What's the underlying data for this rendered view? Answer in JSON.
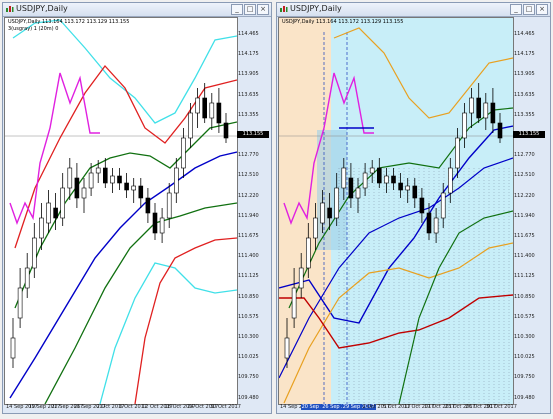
{
  "windows": [
    {
      "title": "USDJPY,Daily",
      "info_line": "USDJPY,Daily  113.164 113.172 113.129 113.155",
      "indicator_label": "3(usgray) 1 (20m) 0",
      "price_ticks": [
        "114.465",
        "114.175",
        "113.905",
        "113.635",
        "113.355",
        "113.085",
        "112.770",
        "112.510",
        "112.220",
        "111.940",
        "111.675",
        "111.400",
        "111.125",
        "110.850",
        "110.575",
        "110.300",
        "110.025",
        "109.750",
        "109.480"
      ],
      "current_price": "113.155",
      "date_ticks": [
        "14 Sep 2017",
        "19 Sep 2017",
        "22 Sep 2017",
        "26 Sep 2017",
        "2 Oct 2017",
        "6 Oct 2017",
        "12 Oct 2017",
        "18 Oct 2017",
        "24 Oct 2017",
        "30 Oct 2017"
      ]
    },
    {
      "title": "USDJPY,Daily",
      "info_line": "USDJPY,Daily  113.164 113.172 113.129 113.155",
      "price_ticks": [
        "114.465",
        "114.175",
        "113.905",
        "113.635",
        "113.355",
        "113.085",
        "112.770",
        "112.510",
        "112.220",
        "111.940",
        "111.675",
        "111.400",
        "111.125",
        "110.850",
        "110.575",
        "110.300",
        "110.025",
        "109.750",
        "109.480"
      ],
      "current_price": "113.155",
      "date_ticks": [
        "14 Sep 2017",
        "20 Sep 2017",
        "26 Sep 2017",
        "29 Sep 2017",
        "2 Oct 2017",
        "5 Oct 2017",
        "11 Oct 2017",
        "17 Oct 2017",
        "23 Oct 2017",
        "26 Oct 2017",
        "30 Oct 2017"
      ],
      "date_ticks_highlighted": [
        false,
        true,
        true,
        true,
        false,
        false,
        false,
        false,
        false,
        false,
        false
      ]
    }
  ],
  "colors": {
    "bull": "#ffffff",
    "bear": "#000000",
    "band_outer": "#40e0e8",
    "band_mid": "#e02020",
    "band_inner": "#107010",
    "ma_blue": "#0000c8",
    "magenta": "#e020e0",
    "cloud": "#c8eef8",
    "orange": "#e8a020",
    "peach": "#fae4c8"
  }
}
